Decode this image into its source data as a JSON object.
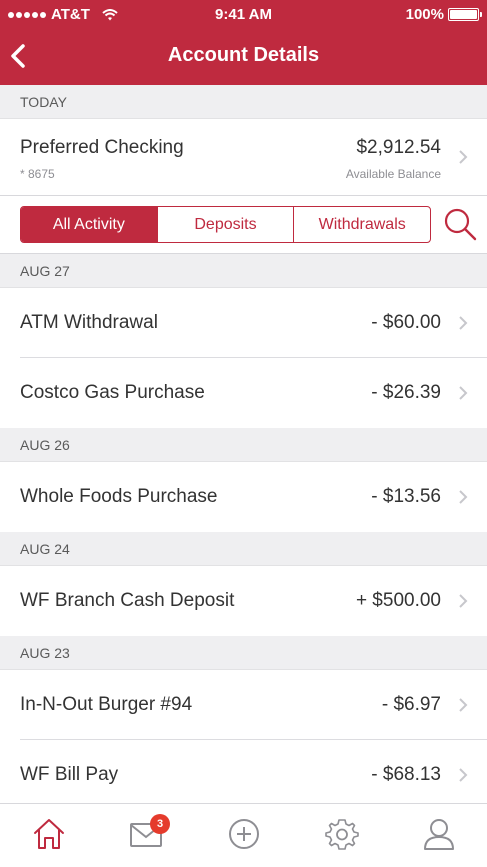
{
  "status_bar": {
    "carrier": "AT&T",
    "time": "9:41 AM",
    "battery": "100%"
  },
  "nav": {
    "title": "Account Details",
    "back_icon": "chevron-left-icon"
  },
  "today_header": "TODAY",
  "account": {
    "name": "Preferred Checking",
    "number": "* 8675",
    "balance": "$2,912.54",
    "balance_label": "Available Balance"
  },
  "filters": {
    "tabs": [
      "All Activity",
      "Deposits",
      "Withdrawals"
    ],
    "selected": "All Activity",
    "search_icon": "search-icon"
  },
  "sections": [
    {
      "date": "AUG 27",
      "transactions": [
        {
          "name": "ATM Withdrawal",
          "amount": "- $60.00"
        },
        {
          "name": "Costco Gas Purchase",
          "amount": "- $26.39"
        }
      ]
    },
    {
      "date": "AUG 26",
      "transactions": [
        {
          "name": "Whole Foods Purchase",
          "amount": "- $13.56"
        }
      ]
    },
    {
      "date": "AUG 24",
      "transactions": [
        {
          "name": "WF Branch Cash Deposit",
          "amount": "+ $500.00"
        }
      ]
    },
    {
      "date": "AUG 23",
      "transactions": [
        {
          "name": "In-N-Out Burger #94",
          "amount": "- $6.97"
        },
        {
          "name": "WF Bill Pay",
          "amount": "- $68.13"
        }
      ]
    }
  ],
  "tab_bar": {
    "items": [
      "home-icon",
      "mail-icon",
      "add-icon",
      "settings-icon",
      "profile-icon"
    ],
    "active": "home-icon",
    "mail_badge": "3"
  },
  "colors": {
    "brand": "#bf2a3f",
    "section_bg": "#efeff1",
    "badge": "#e53b2c"
  }
}
